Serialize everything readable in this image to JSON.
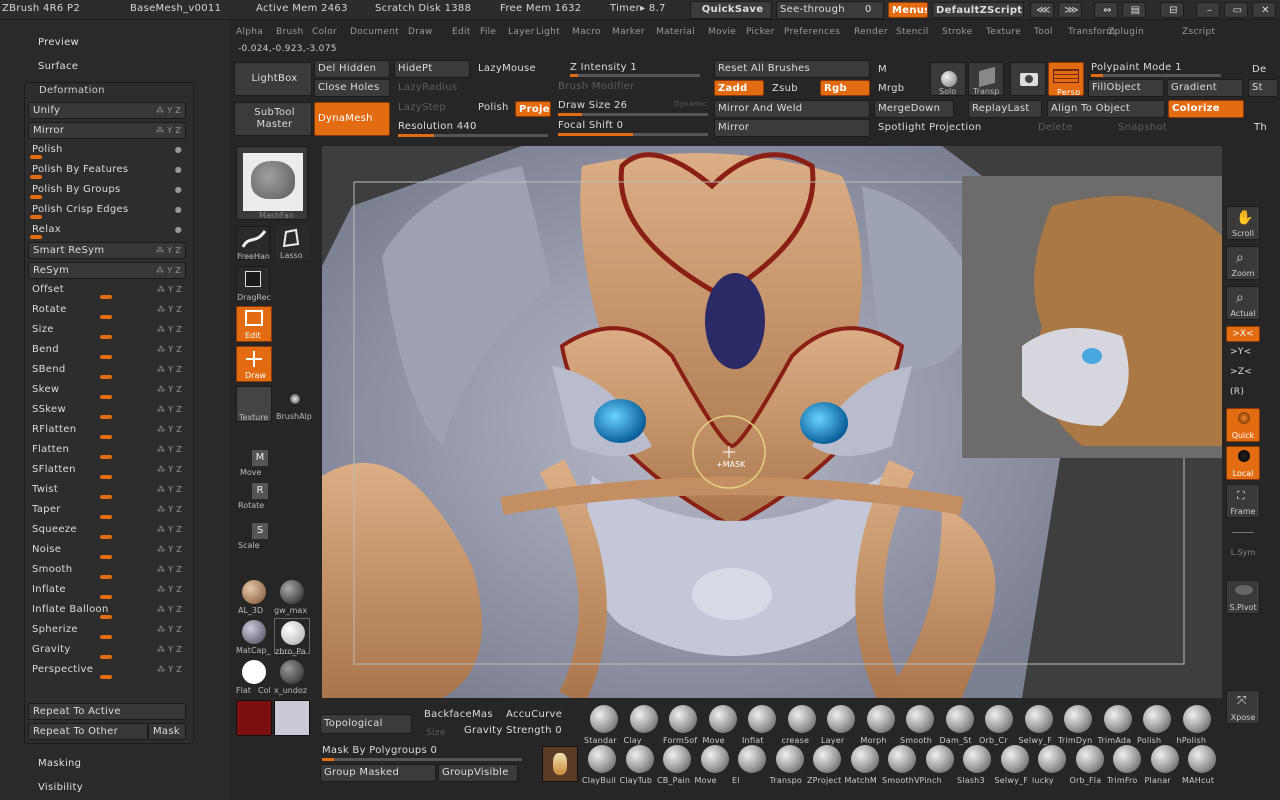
{
  "title_bar": {
    "app": "ZBrush 4R6 P2",
    "document": "BaseMesh_v0011",
    "active_mem": "Active Mem 2463",
    "scratch_disk": "Scratch Disk 1388",
    "free_mem": "Free Mem 1632",
    "timer": "Timer▸ 8.7",
    "quicksave": "QuickSave",
    "see_through": "See-through",
    "see_through_value": "0",
    "menus": "Menus",
    "script": "DefaultZScript"
  },
  "menu_bar": [
    "Alpha",
    "Brush",
    "Color",
    "Document",
    "Draw",
    "Edit",
    "File",
    "Layer",
    "Light",
    "Macro",
    "Marker",
    "Material",
    "Movie",
    "Picker",
    "Preferences",
    "Render",
    "Stencil",
    "Stroke",
    "Texture",
    "Tool",
    "Transform",
    "Zplugin",
    "Zscript"
  ],
  "coords": "-0.024,-0.923,-3.075",
  "left_panel": {
    "top_items": [
      "Preview",
      "Surface"
    ],
    "deformation_header": "Deformation",
    "items": [
      {
        "label": "Unify",
        "type": "box"
      },
      {
        "label": "Mirror",
        "type": "box"
      },
      {
        "label": "Polish",
        "type": "radio"
      },
      {
        "label": "Polish By Features",
        "type": "radio"
      },
      {
        "label": "Polish By Groups",
        "type": "radio"
      },
      {
        "label": "Polish Crisp Edges",
        "type": "radio"
      },
      {
        "label": "Relax",
        "type": "radio"
      },
      {
        "label": "Smart ReSym",
        "type": "box"
      },
      {
        "label": "ReSym",
        "type": "box"
      },
      {
        "label": "Offset",
        "type": "slider"
      },
      {
        "label": "Rotate",
        "type": "slider"
      },
      {
        "label": "Size",
        "type": "slider"
      },
      {
        "label": "Bend",
        "type": "slider"
      },
      {
        "label": "SBend",
        "type": "slider"
      },
      {
        "label": "Skew",
        "type": "slider"
      },
      {
        "label": "SSkew",
        "type": "slider"
      },
      {
        "label": "RFlatten",
        "type": "slider"
      },
      {
        "label": "Flatten",
        "type": "slider"
      },
      {
        "label": "SFlatten",
        "type": "slider"
      },
      {
        "label": "Twist",
        "type": "slider"
      },
      {
        "label": "Taper",
        "type": "slider"
      },
      {
        "label": "Squeeze",
        "type": "slider"
      },
      {
        "label": "Noise",
        "type": "slider"
      },
      {
        "label": "Smooth",
        "type": "slider"
      },
      {
        "label": "Inflate",
        "type": "slider"
      },
      {
        "label": "Inflate Balloon",
        "type": "slider"
      },
      {
        "label": "Spherize",
        "type": "slider"
      },
      {
        "label": "Gravity",
        "type": "slider"
      },
      {
        "label": "Perspective",
        "type": "slider"
      }
    ],
    "repeat_active": "Repeat To Active",
    "repeat_other": "Repeat To Other",
    "mask": "Mask",
    "bottom_items": [
      "Masking",
      "Visibility"
    ]
  },
  "top_shelf": {
    "lightbox": "LightBox",
    "subtool_master": "SubTool Master",
    "dynamesh": "DynaMesh",
    "del_hidden": "Del Hidden",
    "hidept": "HidePt",
    "lazymouse": "LazyMouse",
    "close_holes": "Close Holes",
    "lazy_radius": "LazyRadius",
    "lazy_step": "LazyStep",
    "polish": "Polish",
    "project": "Proje",
    "resolution": "Resolution 440",
    "z_intensity": "Z Intensity 1",
    "brush_modifier": "Brush Modifier",
    "draw_size": "Draw Size 26",
    "dynamic": "Dynamic",
    "focal_shift": "Focal Shift 0",
    "reset_brushes": "Reset All Brushes",
    "zadd": "Zadd",
    "zsub": "Zsub",
    "rgb": "Rgb",
    "mirror_weld": "Mirror And Weld",
    "mirror": "Mirror",
    "m": "M",
    "mrgb": "Mrgb",
    "mergedown": "MergeDown",
    "spotlight": "Spotlight Projection",
    "solo": "Solo",
    "dynamic2": "Dynamic",
    "transp": "Transp",
    "persp": "Persp",
    "replaylast": "ReplayLast",
    "delete": "Delete",
    "polypaint": "Polypaint Mode 1",
    "fillobject": "FillObject",
    "gradient": "Gradient",
    "align": "Align To Object",
    "colorize": "Colorize",
    "snapshot": "Snapshot",
    "de": "De",
    "st": "St",
    "th": "Th"
  },
  "left_tools": {
    "mashfan": "MashFan",
    "freehand": "FreeHan",
    "lasso": "Lasso",
    "dragrect": "DragRec",
    "edit": "Edit",
    "draw": "Draw",
    "texture": "Texture",
    "brushalpha": "BrushAlp",
    "move": "Move",
    "rotate": "Rotate",
    "scale": "Scale",
    "mat1": "AL_3D",
    "mat2": "gw_max",
    "mat3": "MatCap_",
    "mat4": "zbro_Pa",
    "flat": "Flat",
    "col": "Col",
    "undo": "x_undoz"
  },
  "viewport": {
    "cursor_label": "+MASK"
  },
  "right_bar": {
    "scroll": "Scroll",
    "zoom": "Zoom",
    "actual": "Actual",
    "x": ">X<",
    "y": ">Y<",
    "z": ">Z<",
    "r": "(R)",
    "quick": "Quick",
    "local": "Local",
    "frame": "Frame",
    "lsym": "L.Sym",
    "spivot": "S.Pivot",
    "xpose": "Xpose"
  },
  "bottom_shelf": {
    "topological": "Topological",
    "size": "Size",
    "backface": "BackfaceMas",
    "accucurve": "AccuCurve",
    "gravity_strength": "Gravity Strength 0",
    "mask_polygroups": "Mask By Polygroups 0",
    "group_masked": "Group Masked",
    "group_visible": "GroupVisible",
    "brushes_row1": [
      "Standar",
      "Clay",
      "FormSof",
      "Move",
      "Inflat",
      "crease",
      "Layer",
      "Morph",
      "Smooth",
      "Dam_St",
      "Orb_Cr",
      "Selwy_F",
      "TrimDyn",
      "TrimAda",
      "Polish",
      "hPolish"
    ],
    "brushes_row2": [
      "ClayBuil",
      "ClayTub",
      "CB_Pain",
      "Move",
      "El",
      "Transpo",
      "ZProject",
      "MatchM",
      "SmoothV",
      "Pinch",
      "Slash3",
      "Selwy_F",
      "lucky",
      "Orb_Fla",
      "TrimFro",
      "Planar",
      "MAHcut"
    ]
  },
  "colors": {
    "accent": "#e36b12",
    "panel": "#2a2a2a",
    "button": "#3b3b3b",
    "viewport": "#3d3d3d",
    "mask_tan": "#c99468",
    "fur": "#a7abbd"
  }
}
